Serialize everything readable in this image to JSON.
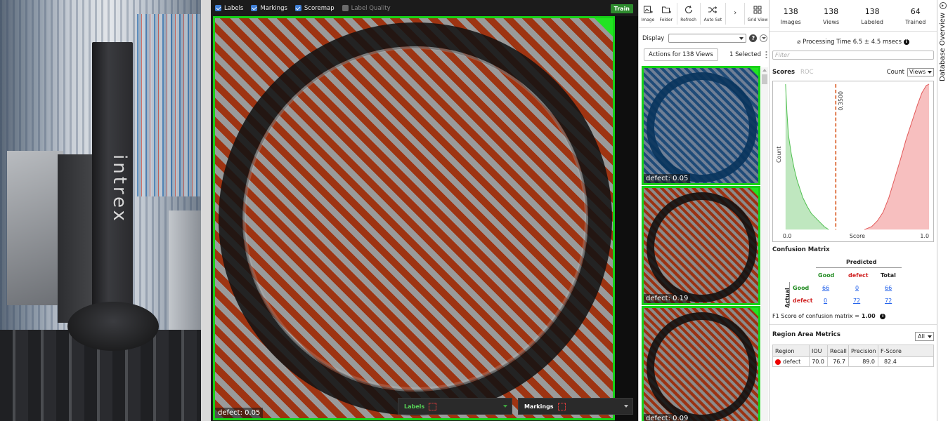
{
  "photo": {
    "brand_text": "intrex"
  },
  "viewer": {
    "toolbar": {
      "labels": "Labels",
      "markings": "Markings",
      "scoremap": "Scoremap",
      "label_quality": "Label Quality",
      "train": "Train"
    },
    "image_label": "defect: 0.05",
    "bottom": {
      "labels": "Labels",
      "markings": "Markings"
    },
    "colors": {
      "frame": "#17d117",
      "overlay": "#9e3412"
    }
  },
  "thumbs": {
    "toolbar": [
      {
        "label": "Image",
        "icon": "image-icon"
      },
      {
        "label": "Folder",
        "icon": "folder-icon"
      },
      {
        "label": "Refresh",
        "icon": "refresh-icon"
      },
      {
        "label": "Auto Set",
        "icon": "shuffle-icon"
      },
      {
        "label": "Grid View",
        "icon": "grid-icon"
      }
    ],
    "display_label": "Display",
    "actions_label": "Actions for 138 Views",
    "selected_label": "1 Selected",
    "cards": [
      {
        "label": "defect: 0.05",
        "style": "blue"
      },
      {
        "label": "defect: 0.19",
        "style": "red"
      },
      {
        "label": "defect: 0.09",
        "style": "red"
      }
    ]
  },
  "panel": {
    "stats": [
      {
        "value": "138",
        "label": "Images"
      },
      {
        "value": "138",
        "label": "Views"
      },
      {
        "value": "138",
        "label": "Labeled"
      },
      {
        "value": "64",
        "label": "Trained"
      }
    ],
    "processing_time": "⌀  Processing Time 6.5 ± 4.5 msecs",
    "filter_placeholder": "Filter",
    "scores_tab": "Scores",
    "roc_tab": "ROC",
    "count_label": "Count",
    "views_select": "Views",
    "confusion": {
      "title": "Confusion Matrix",
      "predicted": "Predicted",
      "actual": "Actual",
      "col_good": "Good",
      "col_defect": "defect",
      "col_total": "Total",
      "row_good": "Good",
      "row_defect": "defect",
      "good_good": "66",
      "good_defect": "0",
      "good_total": "66",
      "defect_good": "0",
      "defect_defect": "72",
      "defect_total": "72",
      "f1_label": "F1 Score of confusion matrix  =",
      "f1_value": "1.00"
    },
    "region": {
      "title": "Region Area Metrics",
      "filter": "All",
      "headers": [
        "Region",
        "IOU",
        "Recall",
        "Precision",
        "F-Score"
      ],
      "row": {
        "region": "defect",
        "iou": "70.0",
        "recall": "76.7",
        "precision": "89.0",
        "fscore": "82.4"
      }
    },
    "side_tab": "Database Overview"
  },
  "chart_data": {
    "type": "area",
    "xlabel": "Score",
    "ylabel": "Count",
    "xlim": [
      0,
      1
    ],
    "x_tick_labels": [
      "0.0",
      "1.0"
    ],
    "threshold": 0.35,
    "threshold_label": "0.3500",
    "series": [
      {
        "color": "#7fcf7f",
        "x": [
          0.0,
          0.01,
          0.02,
          0.04,
          0.06,
          0.08,
          0.1,
          0.12,
          0.15,
          0.18,
          0.21,
          0.24,
          0.27,
          0.3
        ],
        "values": [
          1.0,
          0.8,
          0.65,
          0.52,
          0.42,
          0.34,
          0.28,
          0.22,
          0.16,
          0.11,
          0.08,
          0.05,
          0.02,
          0.0
        ]
      },
      {
        "color": "#f08080",
        "x": [
          0.55,
          0.6,
          0.64,
          0.68,
          0.72,
          0.76,
          0.8,
          0.84,
          0.88,
          0.92,
          0.95,
          0.98,
          1.0
        ],
        "values": [
          0.0,
          0.02,
          0.06,
          0.12,
          0.22,
          0.35,
          0.48,
          0.62,
          0.74,
          0.86,
          0.94,
          0.99,
          1.0
        ]
      }
    ]
  }
}
